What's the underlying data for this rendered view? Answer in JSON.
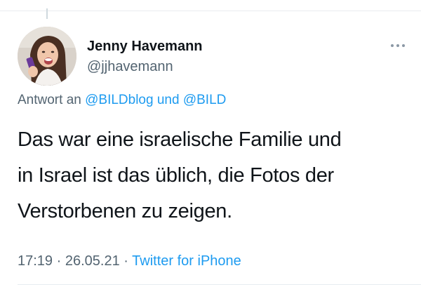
{
  "tweet": {
    "author": {
      "name": "Jenny Havemann",
      "handle": "@jjhavemann"
    },
    "reply": {
      "prefix": "Antwort an",
      "mention1": "@BILDblog",
      "joiner": "und",
      "mention2": "@BILD"
    },
    "text_lines": [
      "Das war eine israelische Familie und",
      "in Israel ist das üblich, die Fotos der",
      "Verstorbenen zu zeigen."
    ],
    "meta": {
      "time": "17:19",
      "separator": "·",
      "date": "26.05.21",
      "source": "Twitter for iPhone"
    },
    "more_icon": "more-horizontal-icon"
  },
  "colors": {
    "link": "#1d9bf0",
    "secondary_text": "#536471",
    "primary_text": "#0f1419"
  }
}
